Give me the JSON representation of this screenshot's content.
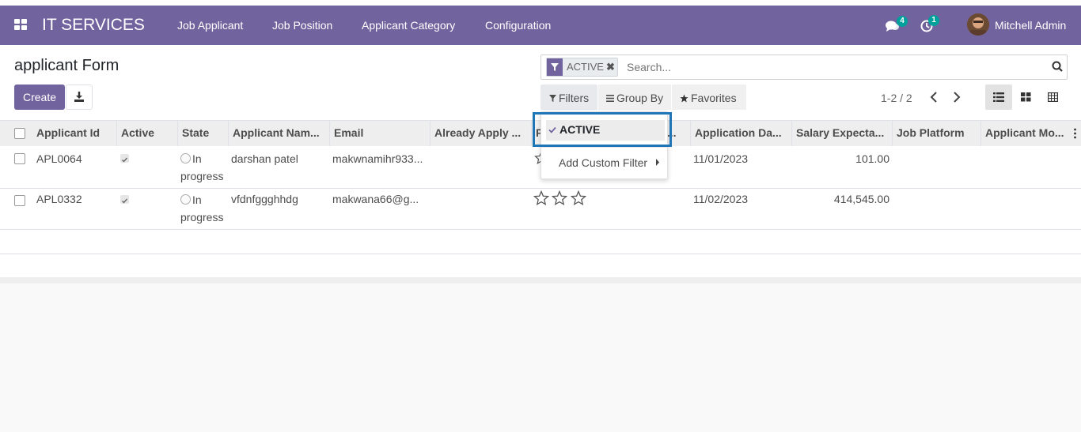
{
  "navbar": {
    "brand": "IT SERVICES",
    "menus": [
      "Job Applicant",
      "Job Position",
      "Applicant Category",
      "Configuration"
    ],
    "messages_count": "4",
    "activities_count": "1",
    "user_name": "Mitchell Admin"
  },
  "page": {
    "title": "applicant Form",
    "create_label": "Create"
  },
  "search": {
    "facet_value": "ACTIVE",
    "placeholder": "Search..."
  },
  "controls": {
    "filters_label": "Filters",
    "groupby_label": "Group By",
    "favorites_label": "Favorites",
    "pager": "1-2 / 2"
  },
  "table": {
    "columns": [
      "Applicant Id",
      "Active",
      "State",
      "Applicant Nam...",
      "Email",
      "Already Apply ...",
      "P",
      "e...",
      "Application Da...",
      "Salary Expecta...",
      "Job Platform",
      "Applicant Mo..."
    ],
    "rows": [
      {
        "id": "APL0064",
        "state_line1": "In",
        "state_line2": "progress",
        "name": "darshan patel",
        "email": "makwnamihr933...",
        "date": "11/01/2023",
        "salary": "101.00"
      },
      {
        "id": "APL0332",
        "state_line1": "In",
        "state_line2": "progress",
        "name": "vfdnfggghhdg",
        "email": "makwana66@g...",
        "date": "11/02/2023",
        "salary": "414,545.00"
      }
    ]
  },
  "filter_dropdown": {
    "active_item": "ACTIVE",
    "custom_filter": "Add Custom Filter"
  },
  "colors": {
    "brand": "#71639e",
    "badge": "#00a09d",
    "highlight": "#1f76b6"
  }
}
